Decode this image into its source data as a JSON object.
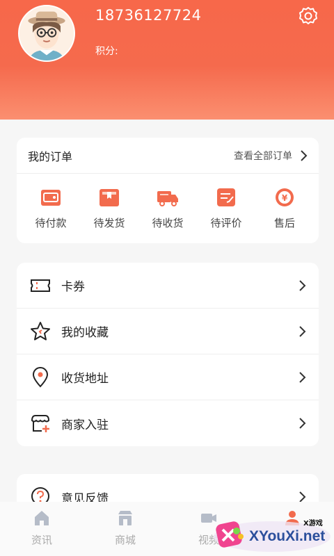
{
  "profile": {
    "phone": "18736127724",
    "points_label": "积分:"
  },
  "orders": {
    "title": "我的订单",
    "view_all": "查看全部订单",
    "statuses": [
      {
        "label": "待付款",
        "icon": "wallet-icon"
      },
      {
        "label": "待发货",
        "icon": "box-icon"
      },
      {
        "label": "待收货",
        "icon": "truck-icon"
      },
      {
        "label": "待评价",
        "icon": "review-icon"
      },
      {
        "label": "售后",
        "icon": "refund-icon"
      }
    ]
  },
  "menu": [
    {
      "label": "卡券",
      "icon": "ticket-icon"
    },
    {
      "label": "我的收藏",
      "icon": "star-icon"
    },
    {
      "label": "收货地址",
      "icon": "location-icon"
    },
    {
      "label": "商家入驻",
      "icon": "store-icon"
    }
  ],
  "menu2": [
    {
      "label": "意见反馈",
      "icon": "feedback-icon"
    }
  ],
  "bottom_nav": [
    {
      "label": "资讯",
      "icon": "home-icon"
    },
    {
      "label": "商城",
      "icon": "shop-icon"
    },
    {
      "label": "视频",
      "icon": "video-icon"
    }
  ],
  "watermark": {
    "small": "X游戏",
    "big": "XYouXi.net"
  },
  "colors": {
    "accent": "#f56a4d",
    "icon_orange": "#f26b4d"
  }
}
